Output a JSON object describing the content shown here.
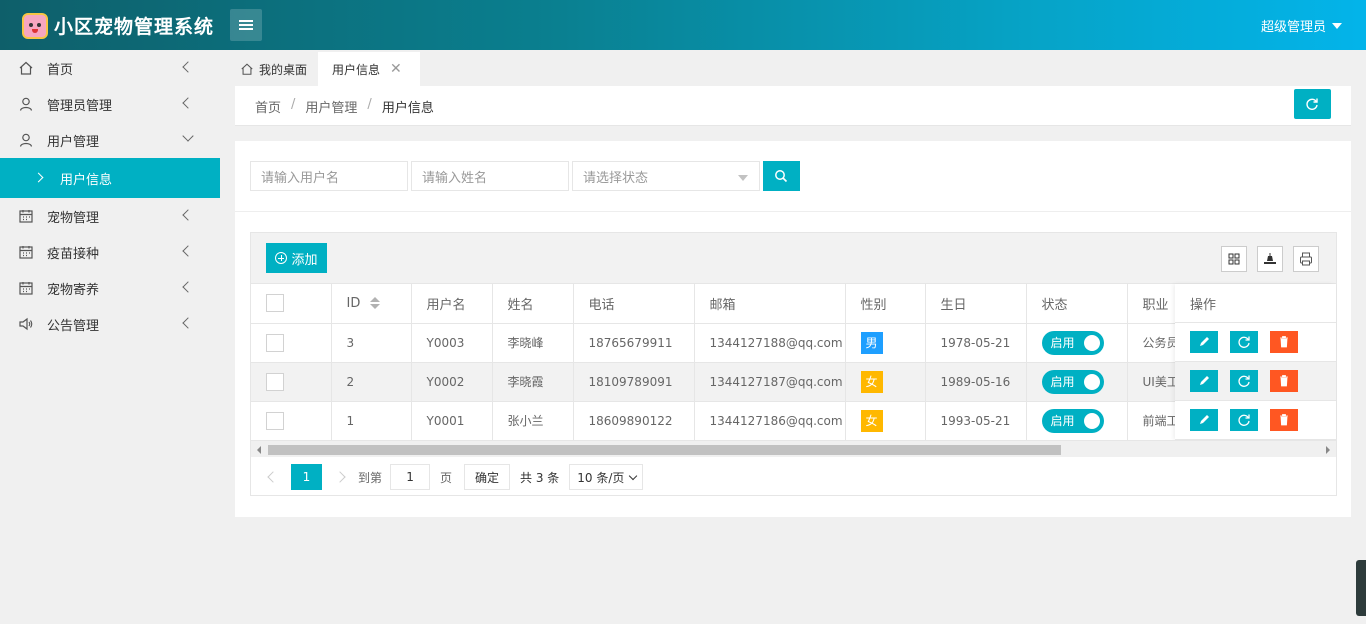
{
  "app": {
    "title": "小区宠物管理系统",
    "user": "超级管理员"
  },
  "sidebar": {
    "items": [
      {
        "label": "首页"
      },
      {
        "label": "管理员管理"
      },
      {
        "label": "用户管理"
      },
      {
        "label": "宠物管理"
      },
      {
        "label": "疫苗接种"
      },
      {
        "label": "宠物寄养"
      },
      {
        "label": "公告管理"
      }
    ],
    "sub_active": "用户信息"
  },
  "tabs": {
    "home": "我的桌面",
    "active": "用户信息"
  },
  "breadcrumb": [
    "首页",
    "用户管理",
    "用户信息"
  ],
  "search": {
    "username_placeholder": "请输入用户名",
    "name_placeholder": "请输入姓名",
    "status_placeholder": "请选择状态"
  },
  "toolbar": {
    "add_label": "添加"
  },
  "table": {
    "headers": [
      "ID",
      "用户名",
      "姓名",
      "电话",
      "邮箱",
      "性别",
      "生日",
      "状态",
      "职业",
      "操作"
    ],
    "rows": [
      {
        "id": "3",
        "username": "Y0003",
        "name": "李晓峰",
        "phone": "18765679911",
        "email": "1344127188@qq.com",
        "gender": "男",
        "birthday": "1978-05-21",
        "status": "启用",
        "job": "公务员"
      },
      {
        "id": "2",
        "username": "Y0002",
        "name": "李晓霞",
        "phone": "18109789091",
        "email": "1344127187@qq.com",
        "gender": "女",
        "birthday": "1989-05-16",
        "status": "启用",
        "job": "UI美工"
      },
      {
        "id": "1",
        "username": "Y0001",
        "name": "张小兰",
        "phone": "18609890122",
        "email": "1344127186@qq.com",
        "gender": "女",
        "birthday": "1993-05-21",
        "status": "启用",
        "job": "前端工"
      }
    ]
  },
  "pager": {
    "current": "1",
    "goto_label": "到第",
    "page_input": "1",
    "page_unit": "页",
    "confirm": "确定",
    "total": "共 3 条",
    "page_size": "10 条/页"
  },
  "colors": {
    "accent": "#00b0c3",
    "male": "#1e9fff",
    "female": "#ffb800",
    "danger": "#ff5722"
  }
}
